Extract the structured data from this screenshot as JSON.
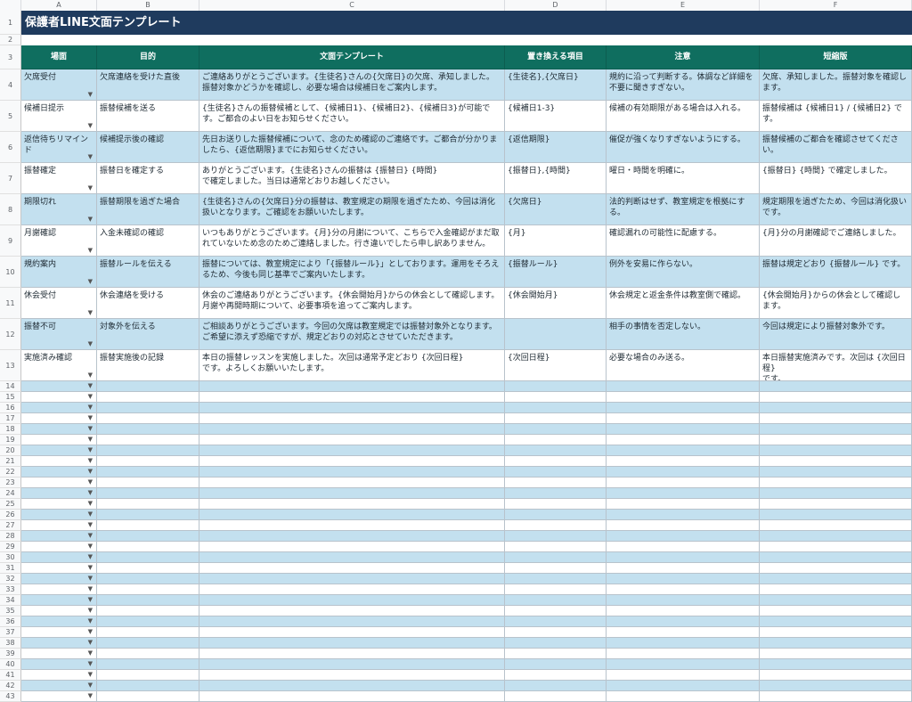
{
  "column_letters": [
    "A",
    "B",
    "C",
    "D",
    "E",
    "F"
  ],
  "sheet_title": "保護者LINE文面テンプレート",
  "headers": [
    "場面",
    "目的",
    "文面テンプレート",
    "置き換える項目",
    "注意",
    "短縮版"
  ],
  "dropdown_glyph": "▼",
  "rows": [
    {
      "num": "4",
      "scene": "欠席受付",
      "purpose": "欠席連絡を受けた直後",
      "template": "ご連絡ありがとうございます。{生徒名}さんの{欠席日}の欠席、承知しました。振替対象かどうかを確認し、必要な場合は候補日をご案内します。",
      "replace": "{生徒名},{欠席日}",
      "note": "規約に沿って判断する。体調など詳細を不要に聞きすぎない。",
      "short": "欠席、承知しました。振替対象を確認します。"
    },
    {
      "num": "5",
      "scene": "候補日提示",
      "purpose": "振替候補を送る",
      "template": "{生徒名}さんの振替候補として、{候補日1}、{候補日2}、{候補日3}が可能です。ご都合のよい日をお知らせください。",
      "replace": "{候補日1-3}",
      "note": "候補の有効期限がある場合は入れる。",
      "short": "振替候補は {候補日1} / {候補日2} です。"
    },
    {
      "num": "6",
      "scene": "返信待ちリマインド",
      "purpose": "候補提示後の確認",
      "template": "先日お送りした振替候補について、念のため確認のご連絡です。ご都合が分かりましたら、{返信期限}までにお知らせください。",
      "replace": "{返信期限}",
      "note": "催促が強くなりすぎないようにする。",
      "short": "振替候補のご都合を確認させてください。"
    },
    {
      "num": "7",
      "scene": "振替確定",
      "purpose": "振替日を確定する",
      "template": "ありがとうございます。{生徒名}さんの振替は {振替日} {時間}\nで確定しました。当日は通常どおりお越しください。",
      "replace": "{振替日},{時間}",
      "note": "曜日・時間を明確に。",
      "short": "{振替日} {時間} で確定しました。"
    },
    {
      "num": "8",
      "scene": "期限切れ",
      "purpose": "振替期限を過ぎた場合",
      "template": "{生徒名}さんの{欠席日}分の振替は、教室規定の期限を過ぎたため、今回は消化扱いとなります。ご確認をお願いいたします。",
      "replace": "{欠席日}",
      "note": "法的判断はせず、教室規定を根拠にする。",
      "short": "規定期限を過ぎたため、今回は消化扱いです。"
    },
    {
      "num": "9",
      "scene": "月謝確認",
      "purpose": "入金未確認の確認",
      "template": "いつもありがとうございます。{月}分の月謝について、こちらで入金確認がまだ取れていないため念のためご連絡しました。行き違いでしたら申し訳ありません。",
      "replace": "{月}",
      "note": "確認漏れの可能性に配慮する。",
      "short": "{月}分の月謝確認でご連絡しました。"
    },
    {
      "num": "10",
      "scene": "規約案内",
      "purpose": "振替ルールを伝える",
      "template": "振替については、教室規定により「{振替ルール}」としております。運用をそろえるため、今後も同じ基準でご案内いたします。",
      "replace": "{振替ルール}",
      "note": "例外を安易に作らない。",
      "short": "振替は規定どおり {振替ルール} です。"
    },
    {
      "num": "11",
      "scene": "休会受付",
      "purpose": "休会連絡を受ける",
      "template": "休会のご連絡ありがとうございます。{休会開始月}からの休会として確認します。月謝や再開時期について、必要事項を追ってご案内します。",
      "replace": "{休会開始月}",
      "note": "休会規定と返金条件は教室側で確認。",
      "short": "{休会開始月}からの休会として確認します。"
    },
    {
      "num": "12",
      "scene": "振替不可",
      "purpose": "対象外を伝える",
      "template": "ご相談ありがとうございます。今回の欠席は教室規定では振替対象外となります。ご希望に添えず恐縮ですが、規定どおりの対応とさせていただきます。",
      "replace": "",
      "note": "相手の事情を否定しない。",
      "short": "今回は規定により振替対象外です。"
    },
    {
      "num": "13",
      "scene": "実施済み確認",
      "purpose": "振替実施後の記録",
      "template": "本日の振替レッスンを実施しました。次回は通常予定どおり {次回日程}\nです。よろしくお願いいたします。",
      "replace": "{次回日程}",
      "note": "必要な場合のみ送る。",
      "short": "本日振替実施済みです。次回は {次回日程}\nです。"
    }
  ],
  "empty_row_numbers": [
    "14",
    "15",
    "16",
    "17",
    "18",
    "19",
    "20",
    "21",
    "22",
    "23",
    "24",
    "25",
    "26",
    "27",
    "28",
    "29",
    "30",
    "31",
    "32",
    "33",
    "34",
    "35",
    "36",
    "37",
    "38",
    "39",
    "40",
    "41",
    "42",
    "43"
  ],
  "colors": {
    "title_bg": "#1f3b5e",
    "header_bg": "#0f6e5f",
    "band_blue": "#c3e0ef"
  }
}
